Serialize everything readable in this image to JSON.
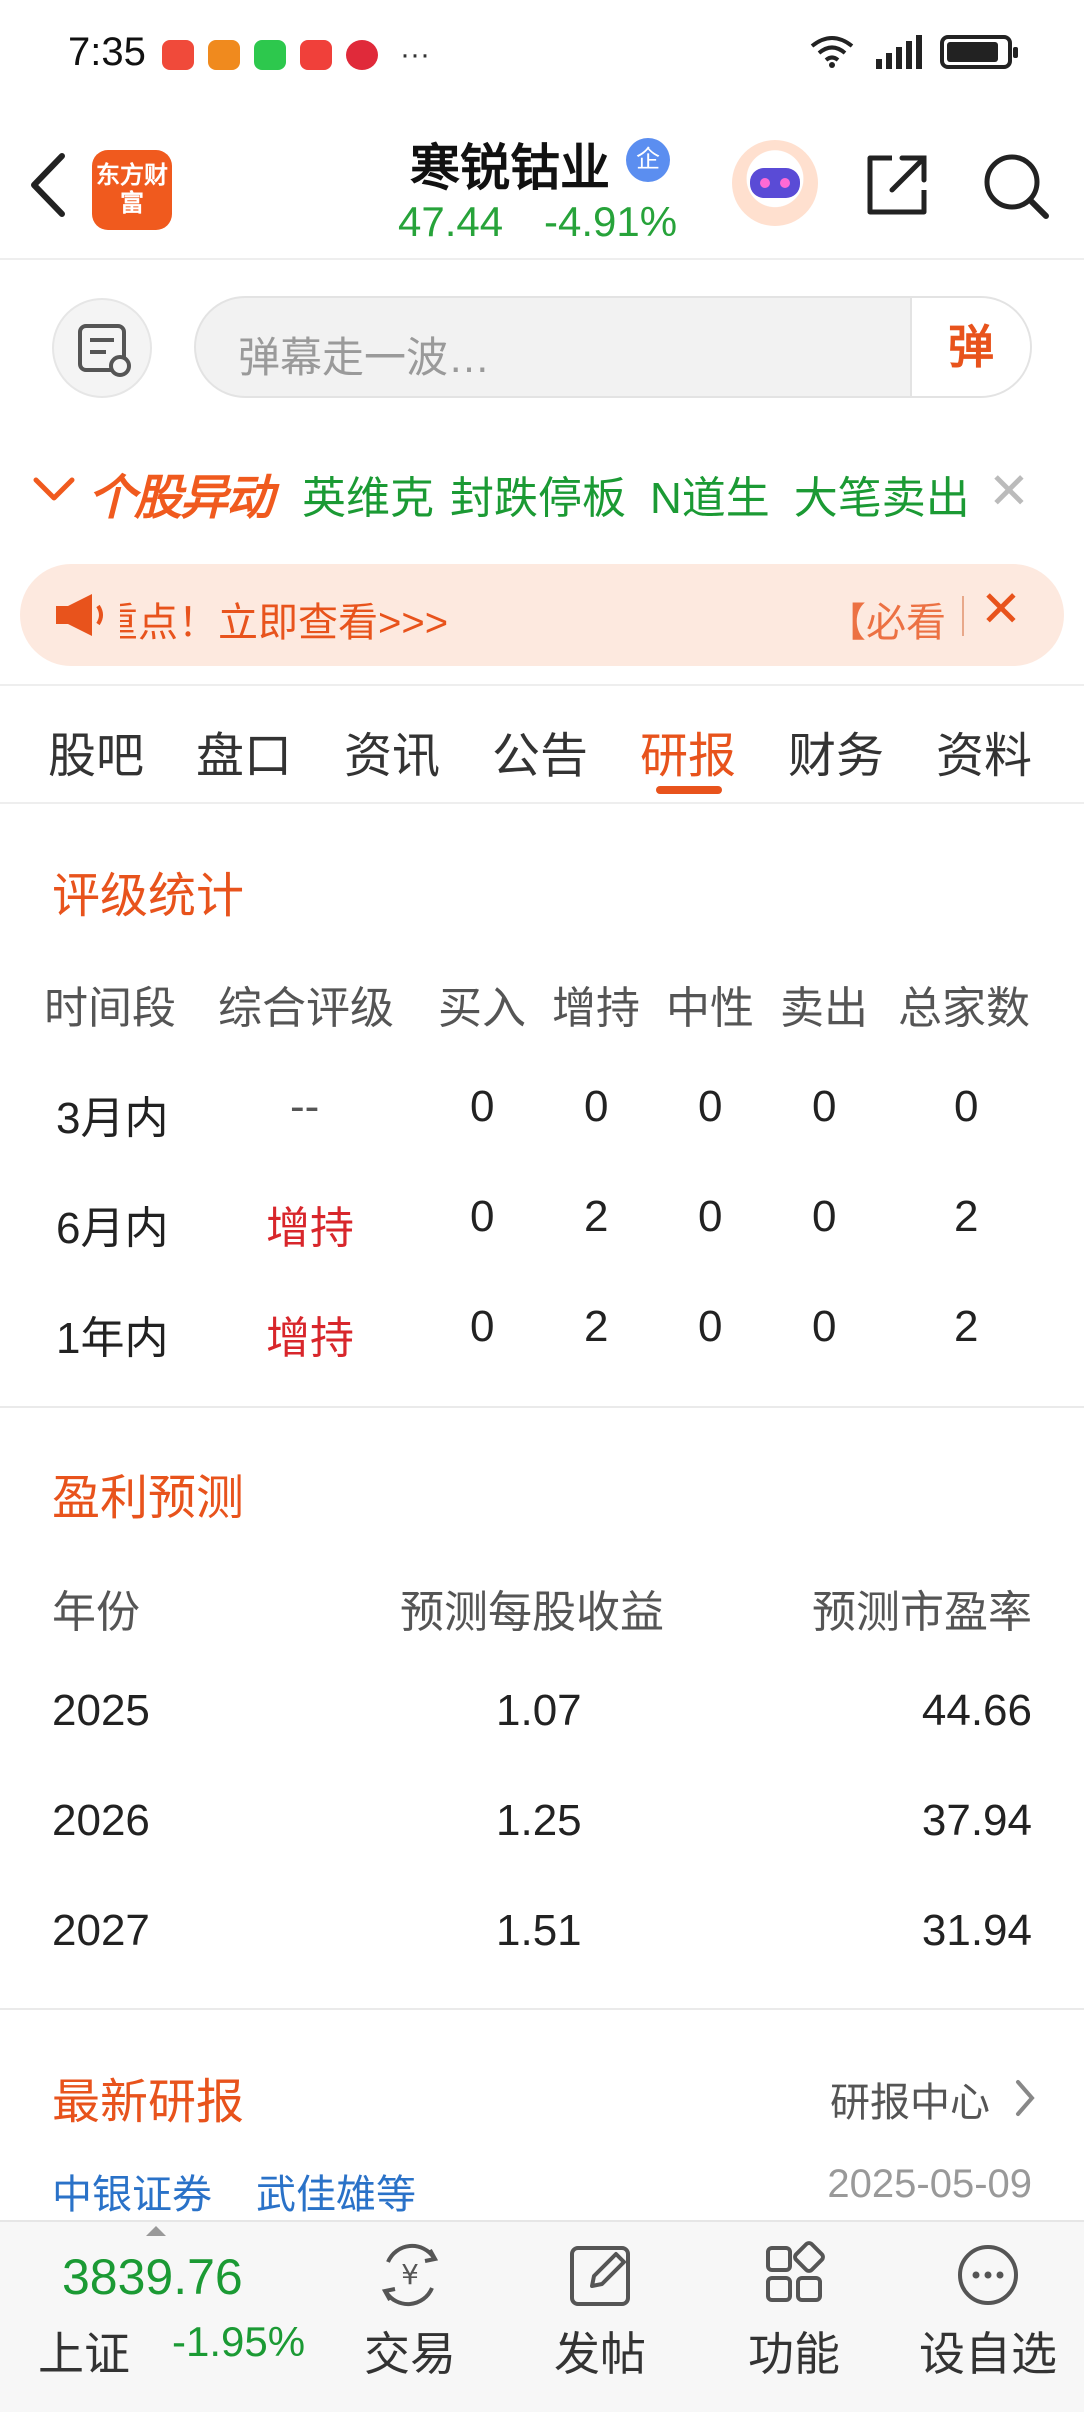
{
  "status_bar": {
    "time": "7:35",
    "overflow": "···"
  },
  "header": {
    "logo_text": "东方财富",
    "stock_name": "寒锐钴业",
    "badge": "企",
    "price": "47.44",
    "change_pct": "-4.91%"
  },
  "comment_bar": {
    "placeholder": "弹幕走一波…",
    "danmu_label": "弹"
  },
  "movers": {
    "title": "个股异动",
    "items": [
      "英维克",
      "封跌停板",
      "N道生",
      "大笔卖出"
    ]
  },
  "banner": {
    "text": "重点！立即查看>>>",
    "text2": "【必看"
  },
  "tabs": [
    "股吧",
    "盘口",
    "资讯",
    "公告",
    "研报",
    "财务",
    "资料"
  ],
  "active_tab": "研报",
  "rating_stats": {
    "title": "评级统计",
    "headers": [
      "时间段",
      "综合评级",
      "买入",
      "增持",
      "中性",
      "卖出",
      "总家数"
    ],
    "rows": [
      [
        "3月内",
        "--",
        "0",
        "0",
        "0",
        "0",
        "0"
      ],
      [
        "6月内",
        "增持",
        "0",
        "2",
        "0",
        "0",
        "2"
      ],
      [
        "1年内",
        "增持",
        "0",
        "2",
        "0",
        "0",
        "2"
      ]
    ]
  },
  "earnings_forecast": {
    "title": "盈利预测",
    "headers": [
      "年份",
      "预测每股收益",
      "预测市盈率"
    ],
    "rows": [
      [
        "2025",
        "1.07",
        "44.66"
      ],
      [
        "2026",
        "1.25",
        "37.94"
      ],
      [
        "2027",
        "1.51",
        "31.94"
      ]
    ]
  },
  "latest_reports": {
    "title": "最新研报",
    "link": "研报中心",
    "first": {
      "broker": "中银证券",
      "author": "武佳雄等",
      "date": "2025-05-09"
    }
  },
  "bottom_bar": {
    "index_value": "3839.76",
    "index_name": "上证",
    "index_change": "-1.95%",
    "nav": [
      "交易",
      "发帖",
      "功能",
      "设自选"
    ]
  },
  "colors": {
    "accent": "#e8531c",
    "down": "#1b9a34",
    "up": "#d8262b"
  }
}
